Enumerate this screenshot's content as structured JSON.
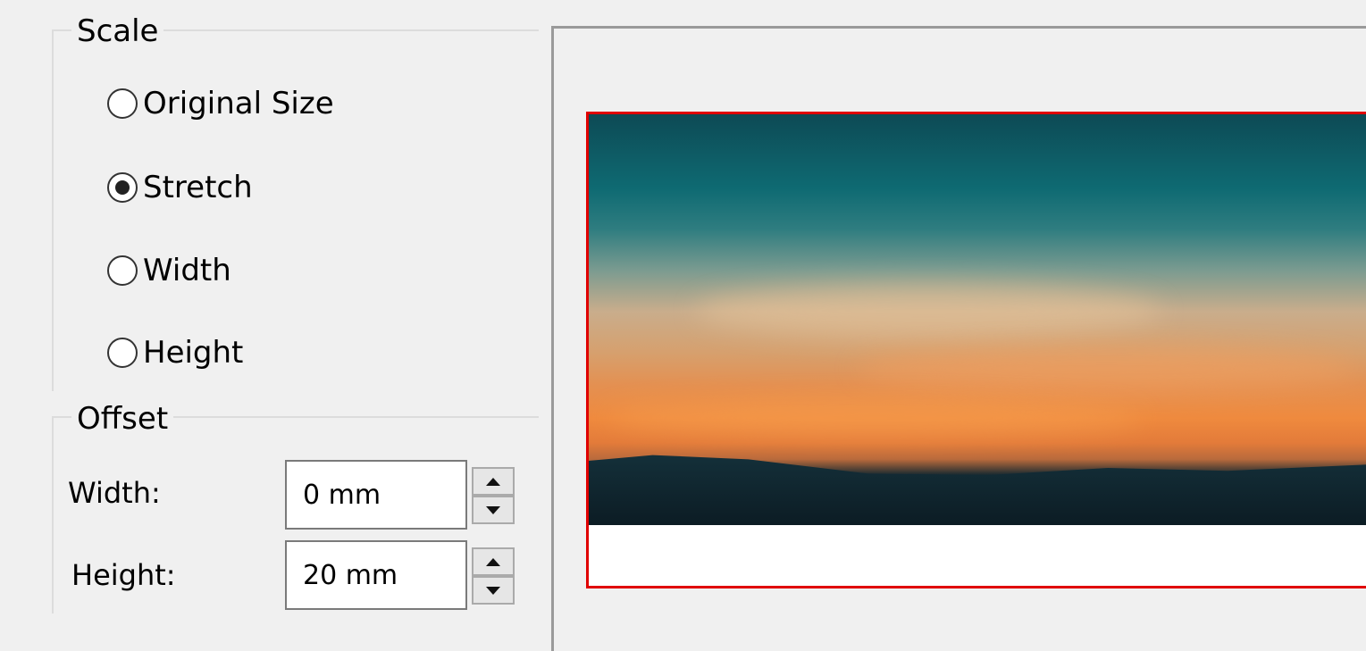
{
  "scale_group": {
    "legend": "Scale",
    "options": [
      {
        "label": "Original Size",
        "selected": false
      },
      {
        "label": "Stretch",
        "selected": true
      },
      {
        "label": "Width",
        "selected": false
      },
      {
        "label": "Height",
        "selected": false
      }
    ]
  },
  "offset_group": {
    "legend": "Offset",
    "width_label": "Width:",
    "width_value": "0 mm",
    "height_label": "Height:",
    "height_value": "20 mm"
  },
  "colors": {
    "page_border": "#e00000",
    "background": "#f0f0f0"
  }
}
